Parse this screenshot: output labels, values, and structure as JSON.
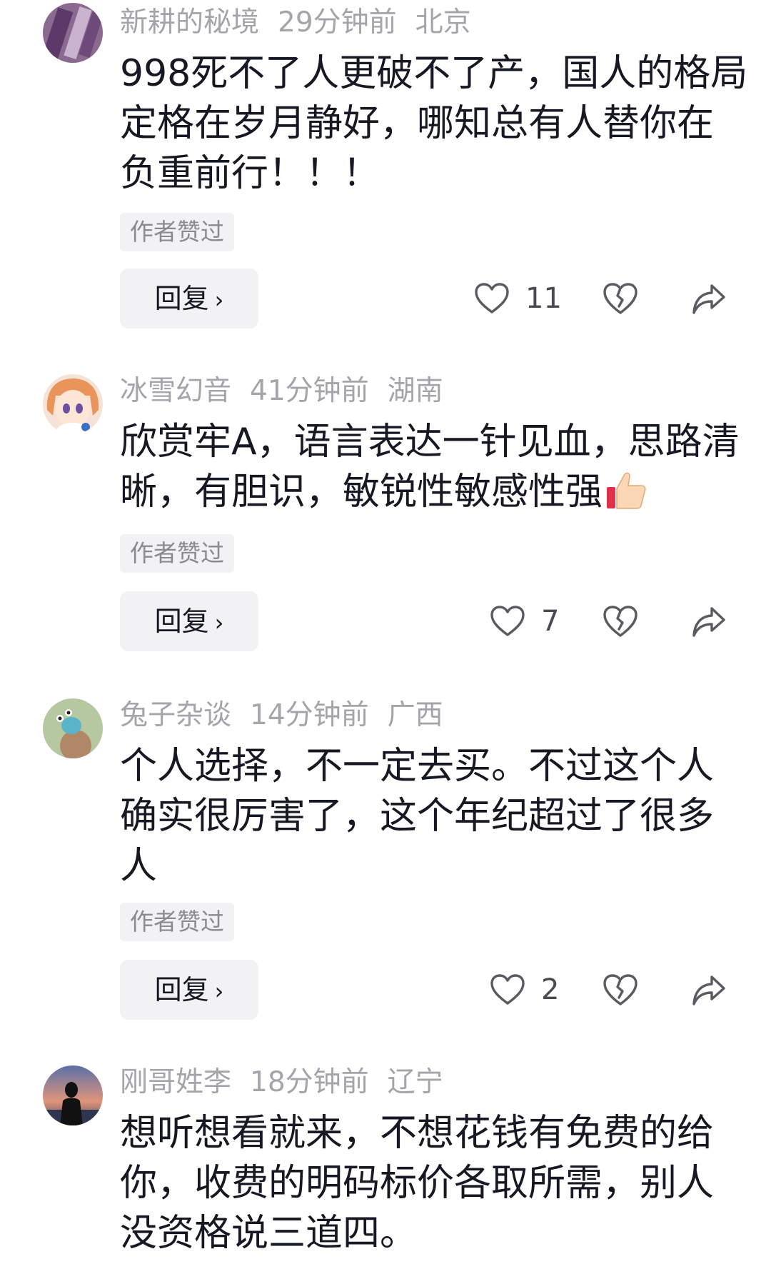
{
  "badge_label": "作者赞过",
  "reply_label": "回复",
  "comments": [
    {
      "username": "新耕的秘境",
      "time": "29分钟前",
      "location": "北京",
      "text": "998死不了人更破不了产，国人的格局定格在岁月静好，哪知总有人替你在负重前行！！！",
      "likes": "11",
      "icons": {
        "like": "heart-outline-icon",
        "dislike": "broken-heart-icon",
        "share": "share-arrow-icon"
      }
    },
    {
      "username": "冰雪幻音",
      "time": "41分钟前",
      "location": "湖南",
      "text": "欣赏牢A，语言表达一针见血，思路清晰，有胆识，敏锐性敏感性强",
      "emoji": "thumbs-up-emoji",
      "likes": "7",
      "icons": {
        "like": "heart-outline-icon",
        "dislike": "broken-heart-icon",
        "share": "share-arrow-icon"
      }
    },
    {
      "username": "兔子杂谈",
      "time": "14分钟前",
      "location": "广西",
      "text": "个人选择，不一定去买。不过这个人确实很厉害了，这个年纪超过了很多人",
      "likes": "2",
      "icons": {
        "like": "heart-outline-icon",
        "dislike": "broken-heart-icon",
        "share": "share-arrow-icon"
      }
    },
    {
      "username": "刚哥姓李",
      "time": "18分钟前",
      "location": "辽宁",
      "text": "想听想看就来，不想花钱有免费的给你，收费的明码标价各取所需，别人没资格说三道四。"
    }
  ]
}
